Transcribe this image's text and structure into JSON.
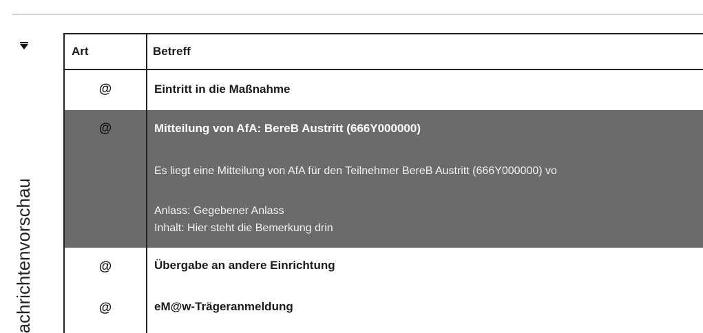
{
  "panel": {
    "title": "achrichtenvorschau",
    "toggle_icon": "triangle-down-icon"
  },
  "table": {
    "columns": {
      "art": "Art",
      "betreff": "Betreff"
    },
    "rows": [
      {
        "art": "@",
        "subject": "Eintritt in die Maßnahme",
        "selected": false
      },
      {
        "art": "@",
        "subject": "Mitteilung von AfA: BereB Austritt (666Y000000)",
        "selected": true,
        "preview": {
          "body": "Es liegt eine Mitteilung von AfA für den Teilnehmer BereB Austritt (666Y000000) vo",
          "anlass": "Anlass: Gegebener Anlass",
          "inhalt": "Inhalt: Hier steht die Bemerkung drin"
        }
      },
      {
        "art": "@",
        "subject": "Übergabe an andere Einrichtung",
        "selected": false
      },
      {
        "art": "@",
        "subject": "eM@w-Trägeranmeldung",
        "selected": false
      }
    ]
  },
  "colors": {
    "selected_row_bg": "#6b6b6b",
    "selected_text": "#ffffff",
    "border": "#222222"
  }
}
